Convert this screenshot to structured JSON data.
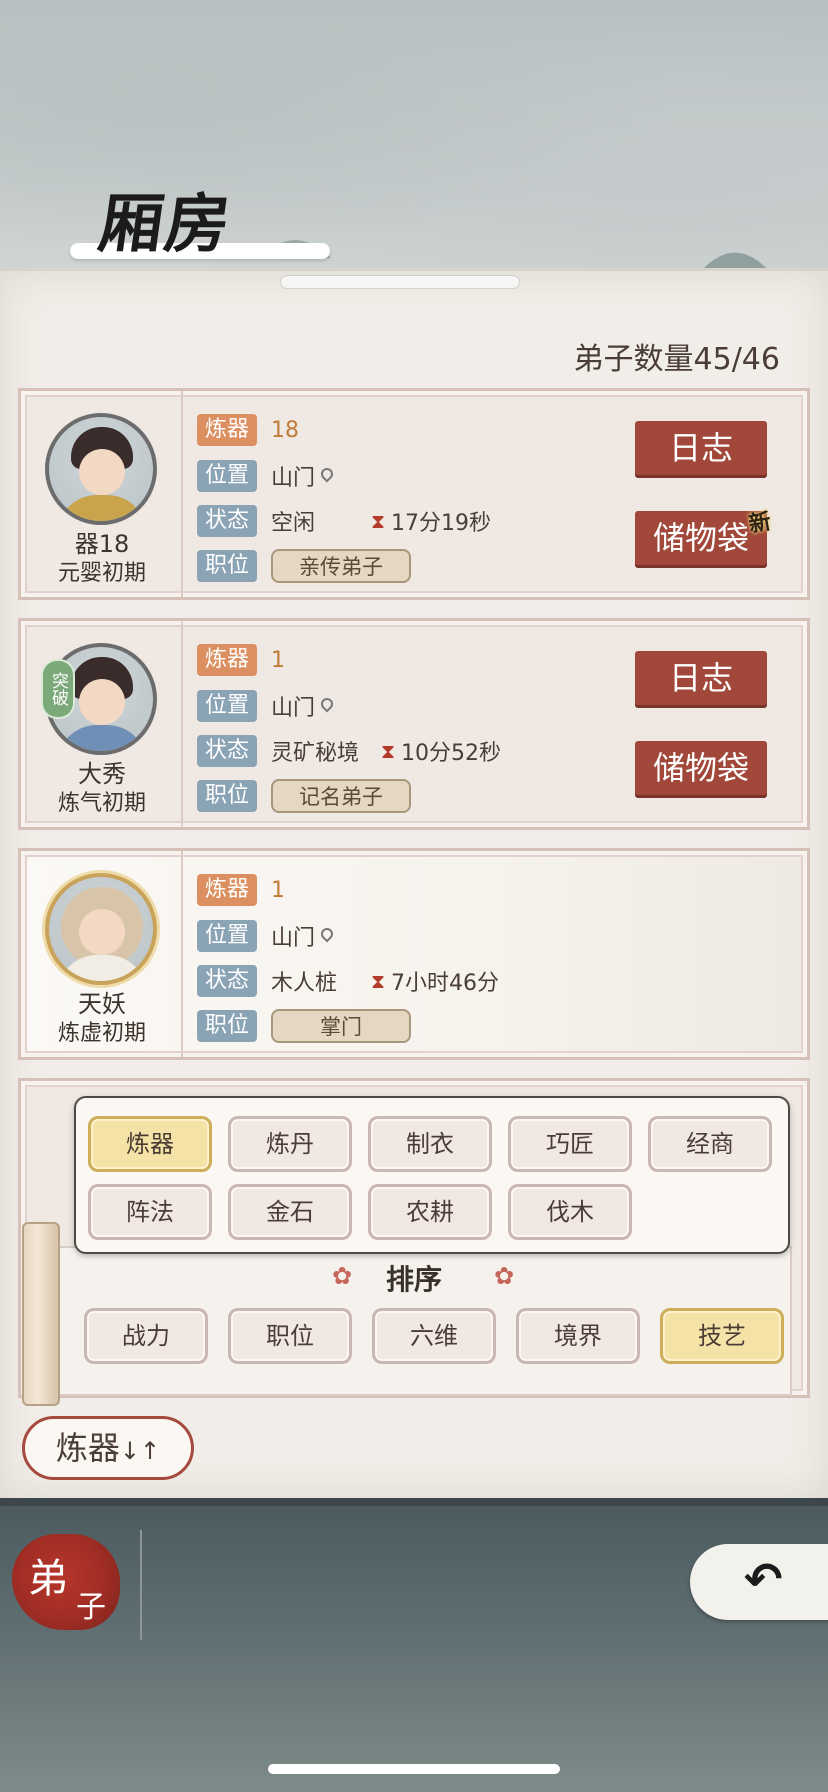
{
  "header": {
    "title": "厢房",
    "disciple_count": "弟子数量45/46"
  },
  "labels": {
    "skill": "炼器",
    "location": "位置",
    "status": "状态",
    "position": "职位"
  },
  "buttons": {
    "log": "日志",
    "storage": "储物袋",
    "new_mark": "新"
  },
  "disciples": [
    {
      "name": "器18",
      "realm": "元婴初期",
      "skill_level": "18",
      "location": "山门",
      "status": "空闲",
      "timer": "17分19秒",
      "position": "亲传弟子",
      "breakthrough": ""
    },
    {
      "name": "大秀",
      "realm": "炼气初期",
      "skill_level": "1",
      "location": "山门",
      "status": "灵矿秘境",
      "timer": "10分52秒",
      "position": "记名弟子",
      "breakthrough": "突破"
    },
    {
      "name": "天妖",
      "realm": "炼虚初期",
      "skill_level": "1",
      "location": "山门",
      "status": "木人桩",
      "timer": "7小时46分",
      "position": "掌门",
      "breakthrough": ""
    }
  ],
  "filter": {
    "skills": [
      "炼器",
      "炼丹",
      "制衣",
      "巧匠",
      "经商",
      "阵法",
      "金石",
      "农耕",
      "伐木"
    ],
    "selected_skill": "炼器",
    "sort_title": "排序",
    "sort_options": [
      "战力",
      "职位",
      "六维",
      "境界",
      "技艺"
    ],
    "selected_sort": "技艺"
  },
  "sort_button": {
    "label": "炼器",
    "arrows": "↓↑"
  },
  "bottom_nav": {
    "tab_a": "弟",
    "tab_b": "子",
    "back_symbol": "↶"
  },
  "colors": {
    "accent_red": "#a2483a",
    "tag_blue": "#8aa3b5",
    "tag_orange": "#dc8f60",
    "chip_active": "#f4e2a6"
  }
}
